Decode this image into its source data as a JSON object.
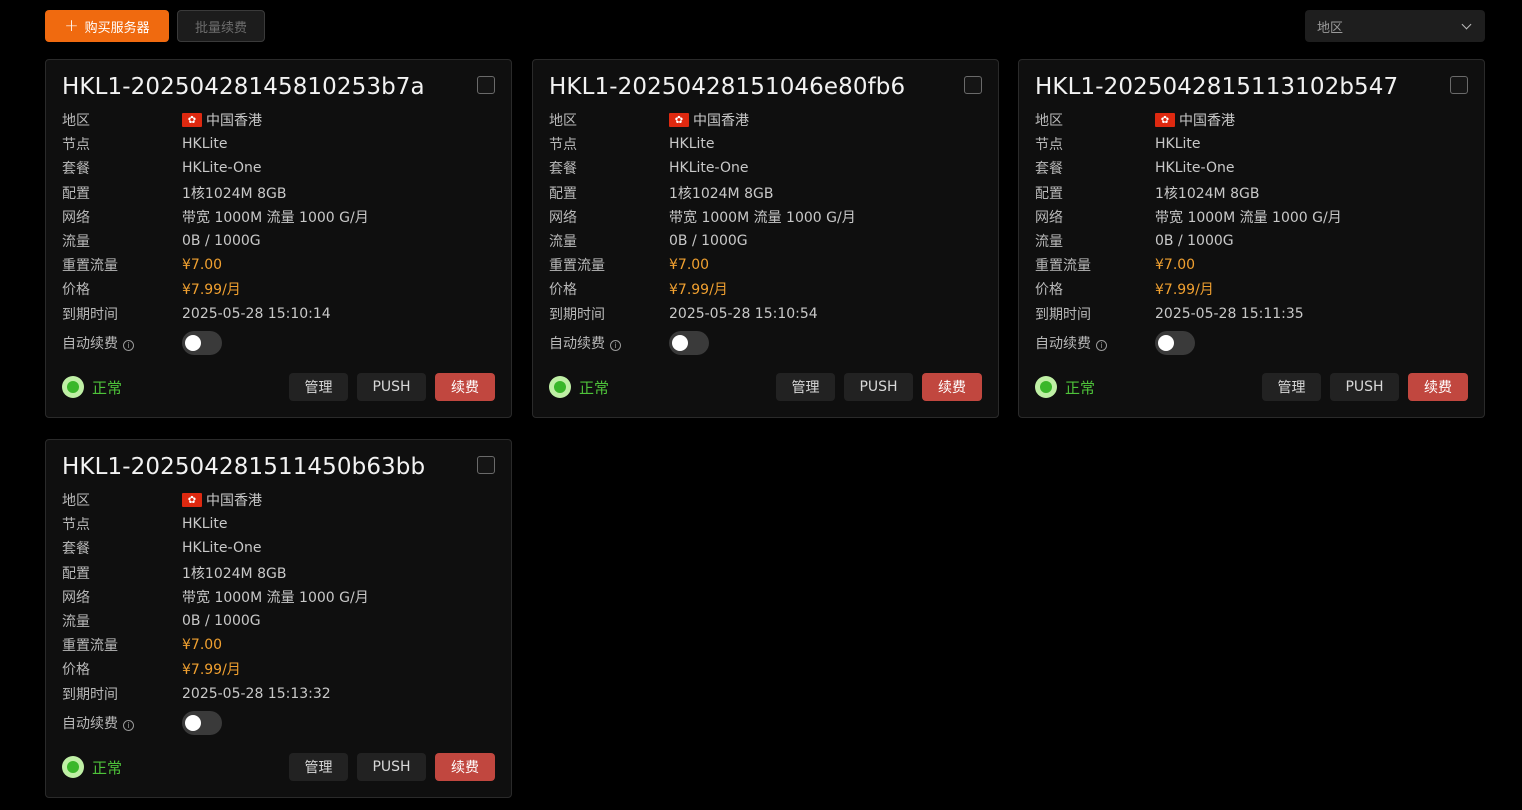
{
  "toolbar": {
    "buy_label": "购买服务器",
    "buy_icon": "plus-icon",
    "batch_label": "批量续费",
    "region_placeholder": "地区"
  },
  "labels": {
    "region": "地区",
    "node": "节点",
    "plan": "套餐",
    "config": "配置",
    "network": "网络",
    "traffic": "流量",
    "reset_traffic": "重置流量",
    "price": "价格",
    "expire": "到期时间",
    "auto_renew": "自动续费"
  },
  "buttons": {
    "manage": "管理",
    "push": "PUSH",
    "renew": "续费"
  },
  "colors": {
    "accent": "#f06a0f",
    "status_ok": "#4ec23a",
    "price": "#f0a030",
    "renew": "#c1473f"
  },
  "servers": [
    {
      "name": "HKL1-20250428145810253b7a",
      "region": "中国香港",
      "node": "HKLite",
      "plan": "HKLite-One",
      "config": "1核1024M 8GB",
      "network": "带宽 1000M 流量 1000 G/月",
      "traffic": "0B / 1000G",
      "reset_traffic": "¥7.00",
      "price": "¥7.99/月",
      "expire": "2025-05-28 15:10:14",
      "auto_renew": false,
      "status": "正常"
    },
    {
      "name": "HKL1-20250428151046e80fb6",
      "region": "中国香港",
      "node": "HKLite",
      "plan": "HKLite-One",
      "config": "1核1024M 8GB",
      "network": "带宽 1000M 流量 1000 G/月",
      "traffic": "0B / 1000G",
      "reset_traffic": "¥7.00",
      "price": "¥7.99/月",
      "expire": "2025-05-28 15:10:54",
      "auto_renew": false,
      "status": "正常"
    },
    {
      "name": "HKL1-202504281511310​2b547",
      "region": "中国香港",
      "node": "HKLite",
      "plan": "HKLite-One",
      "config": "1核1024M 8GB",
      "network": "带宽 1000M 流量 1000 G/月",
      "traffic": "0B / 1000G",
      "reset_traffic": "¥7.00",
      "price": "¥7.99/月",
      "expire": "2025-05-28 15:11:35",
      "auto_renew": false,
      "status": "正常"
    },
    {
      "name": "HKL1-20250428151145 0b63bb",
      "region": "中国香港",
      "node": "HKLite",
      "plan": "HKLite-One",
      "config": "1核1024M 8GB",
      "network": "带宽 1000M 流量 1000 G/月",
      "traffic": "0B / 1000G",
      "reset_traffic": "¥7.00",
      "price": "¥7.99/月",
      "expire": "2025-05-28 15:13:32",
      "auto_renew": false,
      "status": "正常"
    }
  ]
}
